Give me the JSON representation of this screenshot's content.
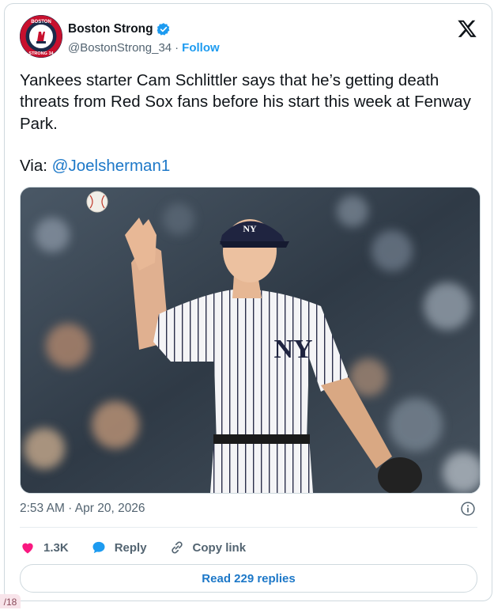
{
  "post": {
    "author": {
      "display_name": "Boston Strong",
      "handle": "@BostonStrong_34",
      "separator": "·",
      "follow_label": "Follow",
      "verified": true,
      "avatar_text_top": "BOSTON",
      "avatar_text_bottom": "STRONG 34"
    },
    "text": "Yankees starter Cam Schlittler says that he’s getting death threats from Red Sox fans before his start this week at Fenway Park.",
    "via_label": "Via:",
    "via_mention": "@Joelsherman1",
    "media_cap_logo": "NY",
    "timestamp": "2:53 AM · Apr 20, 2026",
    "actions": {
      "likes": "1.3K",
      "reply_label": "Reply",
      "copy_link_label": "Copy link"
    },
    "read_replies_label": "Read 229 replies"
  },
  "page_badge": "/18",
  "colors": {
    "accent": "#1d9bf0",
    "link": "#1d78c8",
    "like": "#f91880",
    "muted": "#536471"
  },
  "icons": [
    "verified-badge-icon",
    "x-logo-icon",
    "info-icon",
    "heart-icon",
    "reply-bubble-icon",
    "link-icon"
  ]
}
